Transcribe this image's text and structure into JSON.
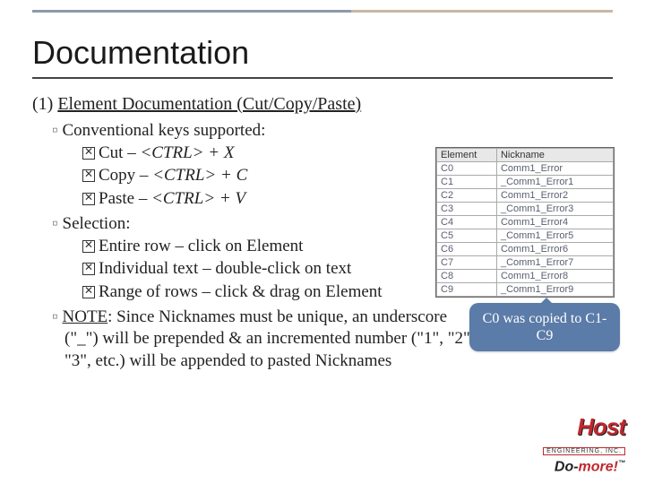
{
  "title": "Documentation",
  "section": {
    "num": "(1)",
    "text": "Element Documentation (Cut/Copy/Paste)"
  },
  "keys_head": "Conventional keys supported:",
  "keys": [
    {
      "label": "Cut – ",
      "combo": "<CTRL> + X"
    },
    {
      "label": "Copy – ",
      "combo": "<CTRL> + C"
    },
    {
      "label": "Paste – ",
      "combo": "<CTRL> + V"
    }
  ],
  "sel_head": "Selection:",
  "sel": [
    {
      "t": "Entire row – click on Element"
    },
    {
      "t": "Individual text – double-click on text"
    },
    {
      "t": "Range of rows – click & drag on Element"
    }
  ],
  "note_label": "NOTE",
  "note_text": ": Since Nicknames must be unique, an underscore (\"_\") will be prepended & an incremented number (\"1\", \"2\", \"3\", etc.) will be appended to pasted Nicknames",
  "table": {
    "headers": [
      "Element",
      "Nickname"
    ],
    "rows": [
      [
        "C0",
        "Comm1_Error"
      ],
      [
        "C1",
        "_Comm1_Error1"
      ],
      [
        "C2",
        "Comm1_Error2"
      ],
      [
        "C3",
        "_Comm1_Error3"
      ],
      [
        "C4",
        "Comm1_Error4"
      ],
      [
        "C5",
        "_Comm1_Error5"
      ],
      [
        "C6",
        "Comm1_Error6"
      ],
      [
        "C7",
        "_Comm1_Error7"
      ],
      [
        "C8",
        "Comm1_Error8"
      ],
      [
        "C9",
        "_Comm1_Error9"
      ]
    ]
  },
  "callout": "C0 was copied to C1-C9",
  "logo": {
    "brand": "Host",
    "eng": "ENGINEERING, INC.",
    "prod1": "Do-",
    "prod2": "more!",
    "tm": "™"
  }
}
